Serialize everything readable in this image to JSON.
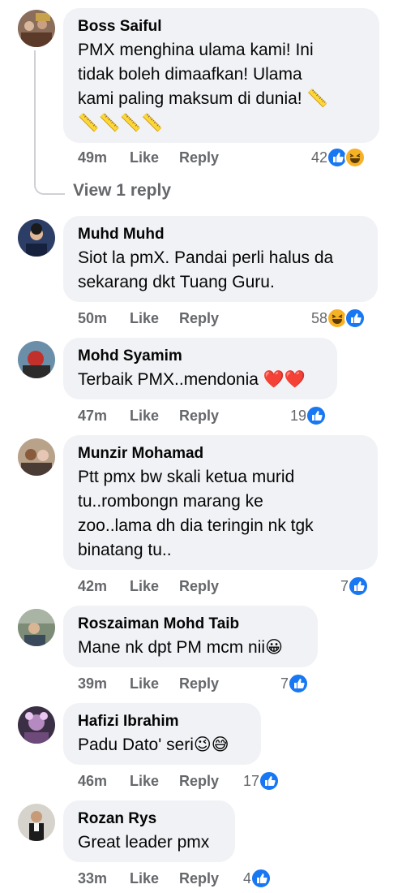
{
  "comments": [
    {
      "name": "Boss Saiful",
      "text_lines": [
        "PMX menghina ulama kami! Ini",
        "tidak boleh dimaafkan! Ulama",
        "kami paling maksum di dunia! 📏",
        "📏📏📏📏"
      ],
      "time": "49m",
      "like": "Like",
      "reply": "Reply",
      "reaction_count": "42",
      "reactions": [
        "like-icon",
        "haha-icon"
      ]
    },
    {
      "name": "Muhd Muhd",
      "text_lines": [
        "Siot la pmX. Pandai perli halus da",
        "sekarang dkt Tuang Guru."
      ],
      "time": "50m",
      "like": "Like",
      "reply": "Reply",
      "reaction_count": "58",
      "reactions": [
        "haha-icon",
        "like-icon"
      ]
    },
    {
      "name": "Mohd Syamim",
      "text_lines": [
        "Terbaik PMX..mendonia ❤️❤️"
      ],
      "time": "47m",
      "like": "Like",
      "reply": "Reply",
      "reaction_count": "19",
      "reactions": [
        "like-icon"
      ]
    },
    {
      "name": "Munzir Mohamad",
      "text_lines": [
        "Ptt pmx bw skali ketua murid",
        "tu..rombongn marang ke",
        "zoo..lama dh dia teringin nk tgk",
        "binatang tu.."
      ],
      "time": "42m",
      "like": "Like",
      "reply": "Reply",
      "reaction_count": "7",
      "reactions": [
        "like-icon"
      ]
    },
    {
      "name": "Roszaiman Mohd Taib",
      "text_lines": [
        "Mane nk dpt PM mcm nii😀"
      ],
      "time": "39m",
      "like": "Like",
      "reply": "Reply",
      "reaction_count": "7",
      "reactions": [
        "like-icon"
      ]
    },
    {
      "name": "Hafizi Ibrahim",
      "text_lines": [
        "Padu Dato' seri😉😅"
      ],
      "time": "46m",
      "like": "Like",
      "reply": "Reply",
      "reaction_count": "17",
      "reactions": [
        "like-icon"
      ]
    },
    {
      "name": "Rozan Rys",
      "text_lines": [
        "Great leader pmx"
      ],
      "time": "33m",
      "like": "Like",
      "reply": "Reply",
      "reaction_count": "4",
      "reactions": [
        "like-icon"
      ]
    }
  ],
  "view_reply": "View 1 reply",
  "colors": {
    "bubble": "#f0f2f5",
    "meta": "#65676b",
    "like_blue": "#1877f2",
    "haha_yellow": "#f7b125"
  }
}
